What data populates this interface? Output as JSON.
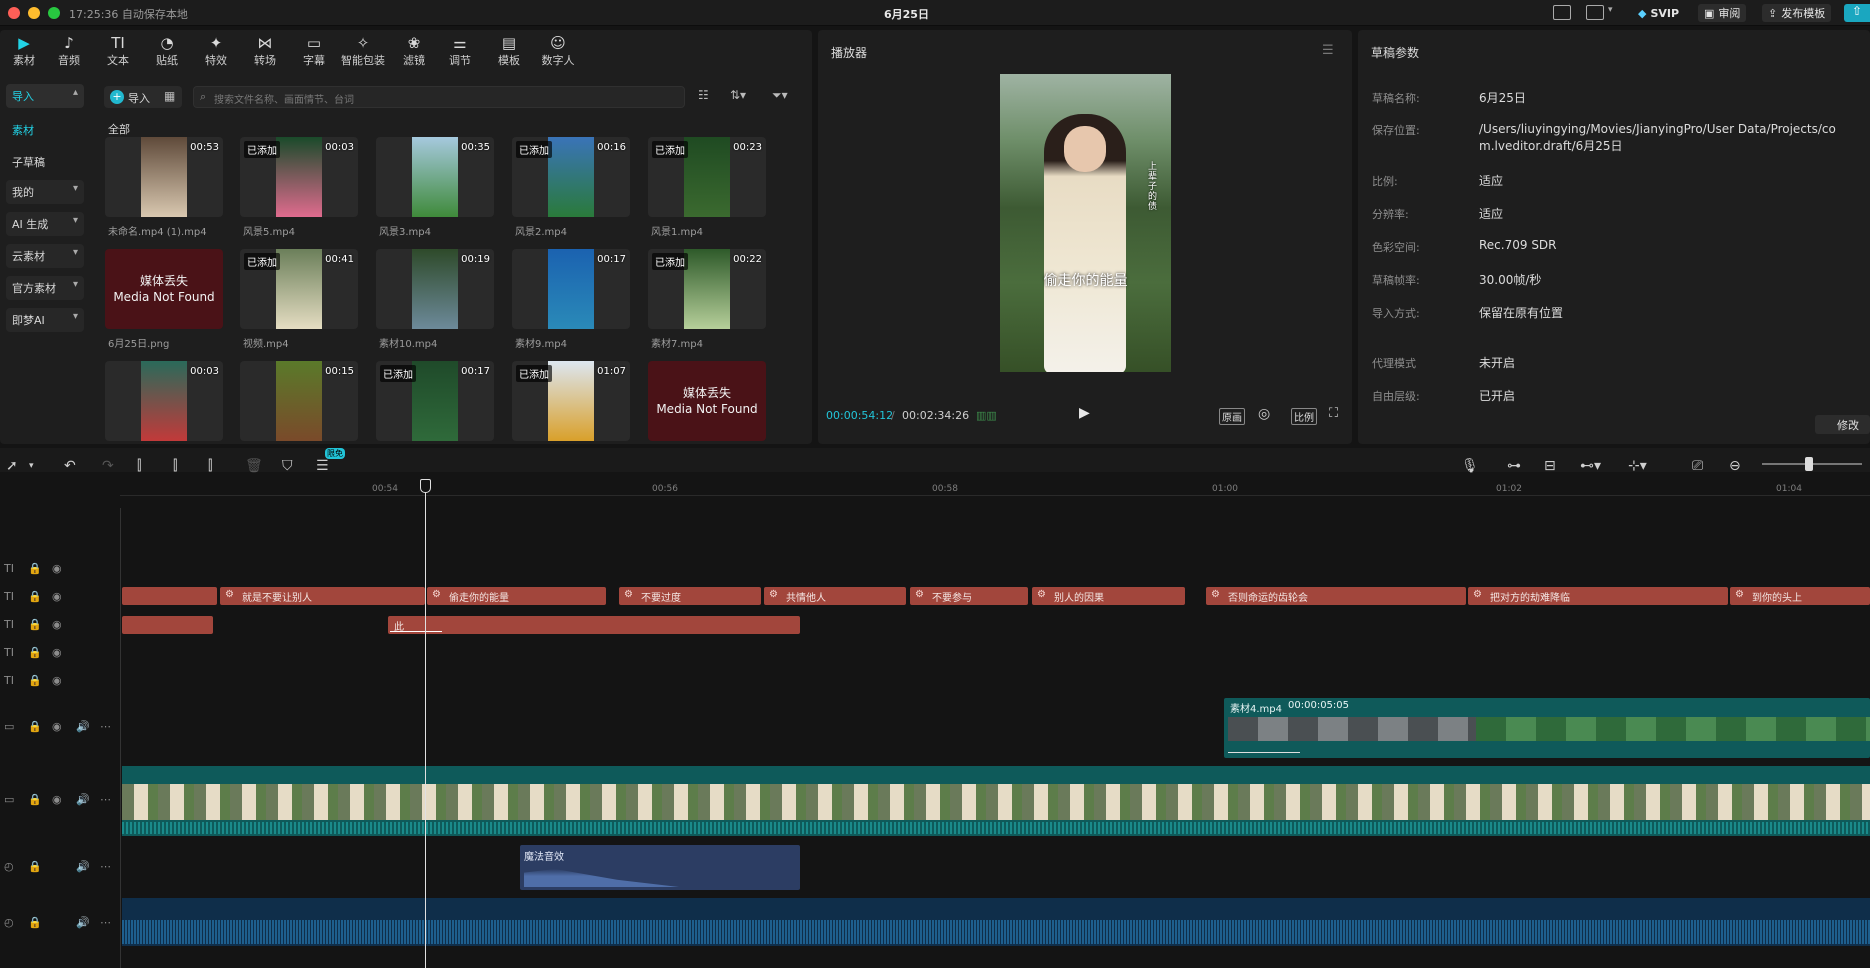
{
  "titlebar": {
    "time_status": "17:25:36 自动保存本地",
    "title": "6月25日",
    "svip": "SVIP",
    "review": "审阅",
    "publish": "发布模板"
  },
  "toolbar": {
    "tabs": [
      {
        "label": "素材",
        "icon": "media-icon"
      },
      {
        "label": "音频",
        "icon": "audio-icon"
      },
      {
        "label": "文本",
        "icon": "text-icon"
      },
      {
        "label": "贴纸",
        "icon": "sticker-icon"
      },
      {
        "label": "特效",
        "icon": "effects-icon"
      },
      {
        "label": "转场",
        "icon": "transition-icon"
      },
      {
        "label": "字幕",
        "icon": "caption-icon"
      },
      {
        "label": "智能包装",
        "icon": "smart-pack-icon"
      },
      {
        "label": "滤镜",
        "icon": "filter-icon"
      },
      {
        "label": "调节",
        "icon": "adjust-icon"
      },
      {
        "label": "模板",
        "icon": "template-icon"
      },
      {
        "label": "数字人",
        "icon": "digital-human-icon"
      }
    ],
    "active_tab": "素材"
  },
  "sidebar": {
    "import": "导入",
    "material": "素材",
    "sub_draft": "子草稿",
    "mine": "我的",
    "ai_gen": "AI 生成",
    "cloud": "云素材",
    "official": "官方素材",
    "jimeng": "即梦AI"
  },
  "media": {
    "import_button": "导入",
    "search_placeholder": "搜索文件名称、画面情节、台词",
    "all_label": "全部",
    "items": [
      {
        "name": "未命名.mp4 (1).mp4",
        "duration": "00:53",
        "added": false,
        "missing": false,
        "colors": [
          "#5f4a3a",
          "#d9c8b0"
        ]
      },
      {
        "name": "风景5.mp4",
        "duration": "00:03",
        "added": true,
        "missing": false,
        "colors": [
          "#1a4a2a",
          "#e06b8e"
        ]
      },
      {
        "name": "风景3.mp4",
        "duration": "00:35",
        "added": false,
        "missing": false,
        "colors": [
          "#a6c9de",
          "#3f8a3a"
        ]
      },
      {
        "name": "风景2.mp4",
        "duration": "00:16",
        "added": true,
        "missing": false,
        "colors": [
          "#3a74b8",
          "#2a7a3a"
        ]
      },
      {
        "name": "风景1.mp4",
        "duration": "00:23",
        "added": true,
        "missing": false,
        "colors": [
          "#1f4a22",
          "#3b6a2f"
        ]
      },
      {
        "name": "6月25日.png",
        "duration": "",
        "added": false,
        "missing": true,
        "colors": [
          "#4a1217",
          "#4a1217"
        ]
      },
      {
        "name": "视频.mp4",
        "duration": "00:41",
        "added": true,
        "missing": false,
        "colors": [
          "#6b7f5a",
          "#e5ddc2"
        ]
      },
      {
        "name": "素材10.mp4",
        "duration": "00:19",
        "added": false,
        "missing": false,
        "colors": [
          "#2e4a2a",
          "#6d8a9a"
        ]
      },
      {
        "name": "素材9.mp4",
        "duration": "00:17",
        "added": false,
        "missing": false,
        "colors": [
          "#1b62b0",
          "#2a8ab8"
        ]
      },
      {
        "name": "素材7.mp4",
        "duration": "00:22",
        "added": true,
        "missing": false,
        "colors": [
          "#2e5a2a",
          "#b6cf9a"
        ]
      },
      {
        "name": "",
        "duration": "00:03",
        "added": false,
        "missing": false,
        "colors": [
          "#2a6a5a",
          "#c23a3a"
        ]
      },
      {
        "name": "",
        "duration": "00:15",
        "added": false,
        "missing": false,
        "colors": [
          "#5a7a2a",
          "#7a4a2a"
        ]
      },
      {
        "name": "",
        "duration": "00:17",
        "added": true,
        "missing": false,
        "colors": [
          "#1f4a2a",
          "#2f6a3a"
        ]
      },
      {
        "name": "",
        "duration": "01:07",
        "added": true,
        "missing": false,
        "colors": [
          "#dce6f0",
          "#d9a02a"
        ]
      },
      {
        "name": "",
        "duration": "",
        "added": false,
        "missing": true,
        "colors": [
          "#4a1217",
          "#4a1217"
        ]
      }
    ],
    "added_label": "已添加",
    "missing_zh": "媒体丢失",
    "missing_en": "Media Not Found"
  },
  "player": {
    "title": "播放器",
    "subtitle_overlay": "偷走你的能量",
    "vertical_text": "上辈子的债",
    "current_time": "00:00:54:12",
    "total_time": "00:02:34:26",
    "btn_original": "原画",
    "btn_ratio": "比例"
  },
  "draft": {
    "title": "草稿参数",
    "rows": [
      {
        "label": "草稿名称:",
        "value": "6月25日"
      },
      {
        "label": "保存位置:",
        "value": "/Users/liuyingying/Movies/JianyingPro/User Data/Projects/com.lveditor.draft/6月25日"
      },
      {
        "label": "比例:",
        "value": "适应"
      },
      {
        "label": "分辨率:",
        "value": "适应"
      },
      {
        "label": "色彩空间:",
        "value": "Rec.709 SDR"
      },
      {
        "label": "草稿帧率:",
        "value": "30.00帧/秒"
      },
      {
        "label": "导入方式:",
        "value": "保留在原有位置"
      },
      {
        "label": "代理模式",
        "value": "未开启"
      },
      {
        "label": "自由层级:",
        "value": "已开启"
      }
    ],
    "modify": "修改"
  },
  "timeline": {
    "free_badge": "限免",
    "ruler": [
      "00:54",
      "00:56",
      "00:58",
      "01:00",
      "01:02",
      "01:04"
    ],
    "text_clips_row1": [
      "就是不要让别人",
      "偷走你的能量",
      "不要过度",
      "共情他人",
      "不要参与",
      "别人的因果",
      "否则命运的齿轮会",
      "把对方的劫难降临",
      "到你的头上"
    ],
    "text_clip_row2": "此",
    "video_clip_name": "素材4.mp4",
    "video_clip_duration": "00:00:05:05",
    "audio_clip_name": "魔法音效"
  }
}
